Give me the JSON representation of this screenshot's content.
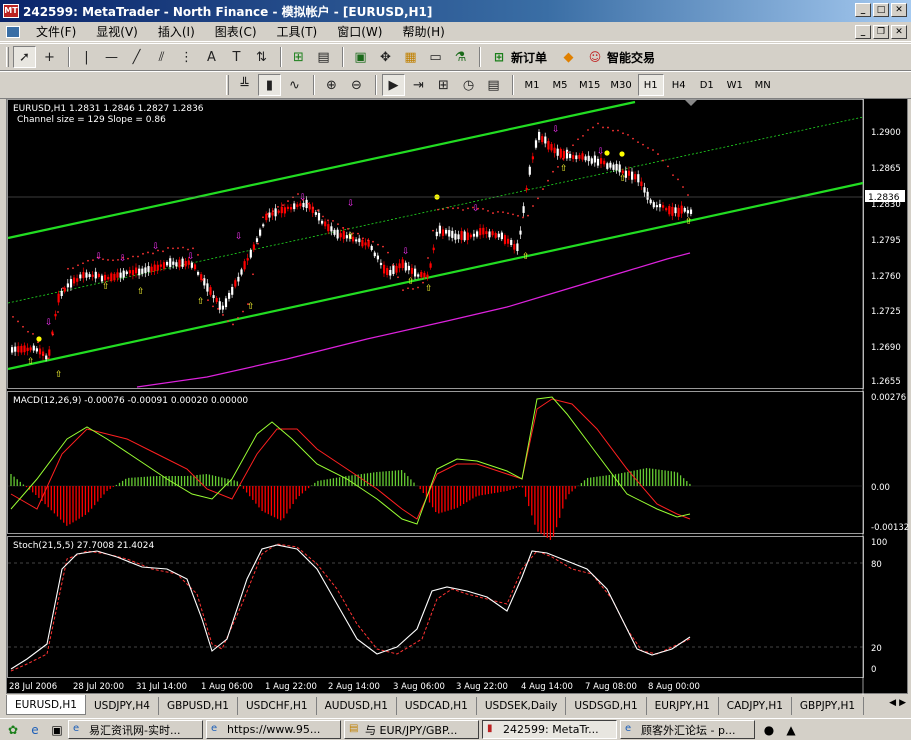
{
  "window": {
    "title": "242599: MetaTrader - North Finance - 模拟帐户 - [EURUSD,H1]"
  },
  "menu": [
    "文件(F)",
    "显视(V)",
    "插入(I)",
    "图表(C)",
    "工具(T)",
    "窗口(W)",
    "帮助(H)"
  ],
  "toolbar": {
    "new_order_label": "新订单",
    "expert_label": "智能交易"
  },
  "timeframes": [
    "M1",
    "M5",
    "M15",
    "M30",
    "H1",
    "H4",
    "D1",
    "W1",
    "MN"
  ],
  "active_timeframe": "H1",
  "main_panel": {
    "info": "EURUSD,H1  1.2831 1.2846 1.2827 1.2836",
    "channel_info": "Channel size = 129 Slope = 0.86",
    "price_ticks": [
      "1.2900",
      "1.2865",
      "1.2830",
      "1.2795",
      "1.2760",
      "1.2725",
      "1.2690",
      "1.2655"
    ],
    "current_price": "1.2836"
  },
  "macd_panel": {
    "info": "MACD(12,26,9) -0.00076 -0.00091 0.00020 0.00000",
    "ticks": [
      "0.00276",
      "0.00",
      "-0.00132"
    ]
  },
  "stoch_panel": {
    "info": "Stoch(21,5,5) 27.7008 21.4024",
    "ticks": [
      "100",
      "80",
      "20",
      "0"
    ]
  },
  "time_labels": [
    "28 Jul 2006",
    "28 Jul 20:00",
    "31 Jul 14:00",
    "1 Aug 06:00",
    "1 Aug 22:00",
    "2 Aug 14:00",
    "3 Aug 06:00",
    "3 Aug 22:00",
    "4 Aug 14:00",
    "7 Aug 08:00",
    "8 Aug 00:00"
  ],
  "chart_tabs": [
    "EURUSD,H1",
    "USDJPY,H4",
    "GBPUSD,H1",
    "USDCHF,H1",
    "AUDUSD,H1",
    "USDCAD,H1",
    "USDSEK,Daily",
    "USDSGD,H1",
    "EURJPY,H1",
    "CADJPY,H1",
    "GBPJPY,H1"
  ],
  "active_chart_tab": "EURUSD,H1",
  "taskbar": [
    "易汇资讯网-实时...",
    "https://www.95...",
    "与 EUR/JPY/GBP...",
    "242599: MetaTr...",
    "顾客外汇论坛 - p..."
  ],
  "colors": {
    "background": "#000000",
    "bull": "#ffffff",
    "bear": "#ff0000",
    "channel": "#22dd22",
    "ma": "#dd22dd",
    "sar": "#ff3333",
    "macd_signal": "#ff2020",
    "macd_main": "#99ff33",
    "stoch_main": "#ffffff",
    "stoch_signal": "#ff3333"
  }
}
